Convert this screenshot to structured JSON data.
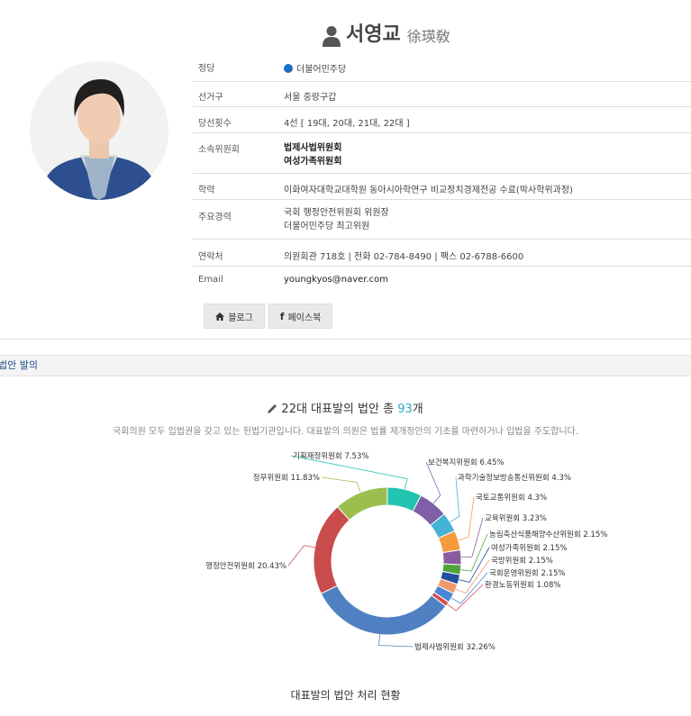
{
  "header": {
    "name": "서영교",
    "hanja": "徐瑛敎"
  },
  "profile": {
    "party": {
      "label": "정당",
      "value": "더불어민주당"
    },
    "district": {
      "label": "선거구",
      "value": "서울 중랑구갑"
    },
    "terms": {
      "label": "당선횟수",
      "value": "4선 [ 19대, 20대, 21대, 22대 ]"
    },
    "committee": {
      "label": "소속위원회",
      "line1": "법제사법위원회",
      "line2": "여성가족위원회"
    },
    "education": {
      "label": "학력",
      "value": "이화여자대학교대학원 동아시아학연구 비교정치경제전공 수료(박사학위과정)"
    },
    "career": {
      "label": "주요경력",
      "line1": "국회 행정안전위원회 위원장",
      "line2": "더불어민주당 최고위원"
    },
    "contact": {
      "label": "연락처",
      "value": "의원회관 718호 | 전화 02-784-8490 | 팩스 02-6788-6600"
    },
    "email": {
      "label": "Email",
      "value": "youngkyos@naver.com"
    }
  },
  "buttons": {
    "blog": "블로그",
    "facebook": "페이스북"
  },
  "section": {
    "title": "법안 발의"
  },
  "chart_header": {
    "prefix": "22대 대표발의 법안 총 ",
    "count": "93",
    "suffix": "개"
  },
  "chart_desc": "국회의원 모두 입법권을 갖고 있는 헌법기관입니다. 대표발의 의원은 법률 제개정안의 기초를 마련하거나 입법을 주도합니다.",
  "bottom_title": "대표발의 법안 처리 현황",
  "icons": {
    "name": "person-icon",
    "blog": "home-icon",
    "facebook": "facebook-icon",
    "chart": "pencil-icon"
  },
  "chart_data": {
    "type": "pie",
    "donut": true,
    "categories": [
      "기획재정위원회",
      "보건복지위원회",
      "과학기술정보방송통신위원회",
      "국토교통위원회",
      "교육위원회",
      "농림축산식품해양수산위원회",
      "여성가족위원회",
      "국방위원회",
      "국회운영위원회",
      "환경노동위원회",
      "법제사법위원회",
      "행정안전위원회",
      "정무위원회"
    ],
    "values": [
      7.53,
      6.45,
      4.3,
      4.3,
      3.23,
      2.15,
      2.15,
      2.15,
      2.15,
      1.08,
      32.26,
      20.43,
      11.83
    ],
    "labels": [
      "기획재정위원회 7.53%",
      "보건복지위원회 6.45%",
      "과학기술정보방송통신위원회 4.3%",
      "국토교통위원회 4.3%",
      "교육위원회 3.23%",
      "농림축산식품해양수산위원회 2.15%",
      "여성가족위원회 2.15%",
      "국방위원회 2.15%",
      "국회운영위원회 2.15%",
      "환경노동위원회 1.08%",
      "법제사법위원회 32.26%",
      "행정안전위원회 20.43%",
      "정무위원회 11.83%"
    ],
    "colors": [
      "#20c4b0",
      "#7e5fa8",
      "#44b3d4",
      "#f59a3d",
      "#8a5ba0",
      "#4fa33c",
      "#214f9e",
      "#ef9a6a",
      "#4a86d4",
      "#d84c48",
      "#4f81c2",
      "#c94c4c",
      "#9bbf4f"
    ]
  }
}
